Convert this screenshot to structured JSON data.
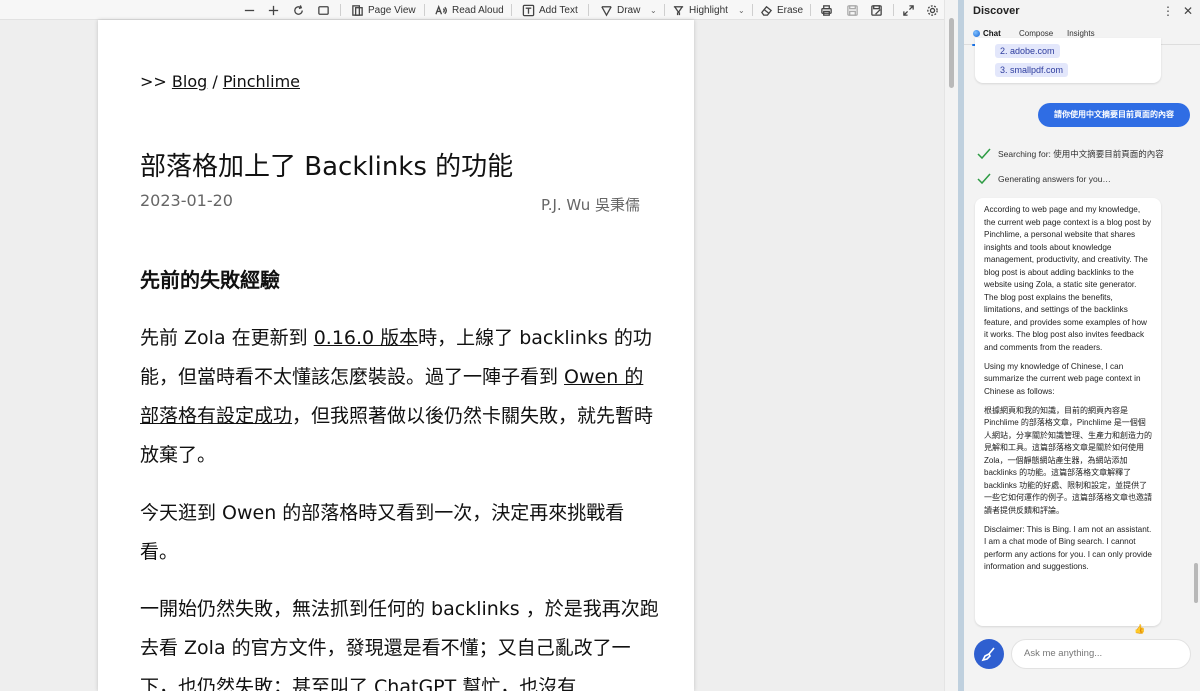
{
  "toolbar": {
    "page_view": "Page View",
    "read_aloud": "Read Aloud",
    "add_text": "Add Text",
    "draw": "Draw",
    "highlight": "Highlight",
    "erase": "Erase"
  },
  "document": {
    "crumb_prefix": ">>",
    "crumb_blog": "Blog",
    "crumb_sep": "/",
    "crumb_site": "Pinchlime",
    "title": "部落格加上了 Backlinks 的功能",
    "date": "2023-01-20",
    "author": "P.J. Wu 吳秉儒",
    "section_heading": "先前的失敗經驗",
    "p1_a": "先前 Zola 在更新到 ",
    "p1_link1": "0.16.0 版本",
    "p1_b": "時，上線了 backlinks 的功能，但當時看不太懂該怎麼裝設。過了一陣子看到 ",
    "p1_link2": "Owen 的部落格有設定成功",
    "p1_c": "，但我照著做以後仍然卡關失敗，就先暫時放棄了。",
    "p2": "今天逛到 Owen 的部落格時又看到一次，決定再來挑戰看看。",
    "p3": "一開始仍然失敗，無法抓到任何的 backlinks ，於是我再次跑去看 Zola 的官方文件，發現還是看不懂；又自己亂改了一下，也仍然失敗；甚至叫了 ChatGPT 幫忙，也沒有"
  },
  "sidebar": {
    "title": "Discover",
    "tabs": {
      "chat": "Chat",
      "compose": "Compose",
      "insights": "Insights"
    },
    "citations": [
      "2. adobe.com",
      "3. smallpdf.com"
    ],
    "user_message": "請你使用中文摘要目前頁面的內容",
    "status1": "Searching for: 使用中文摘要目前頁面的內容",
    "status2": "Generating answers for you…",
    "answer": {
      "p1": "According to web page and my knowledge, the current web page context is a blog post by Pinchlime, a personal website that shares insights and tools about knowledge management, productivity, and creativity. The blog post is about adding backlinks to the website using Zola, a static site generator. The blog post explains the benefits, limitations, and settings of the backlinks feature, and provides some examples of how it works. The blog post also invites feedback and comments from the readers.",
      "p2": "Using my knowledge of Chinese, I can summarize the current web page context in Chinese as follows:",
      "p3": "根據網頁和我的知識，目前的網頁內容是 Pinchlime 的部落格文章，Pinchlime 是一個個人網站，分享關於知識管理、生產力和創造力的見解和工具。這篇部落格文章是關於如何使用 Zola，一個靜態網站產生器，為網站添加 backlinks 的功能。這篇部落格文章解釋了 backlinks 功能的好處、限制和設定，並提供了一些它如何運作的例子。這篇部落格文章也邀請讀者提供反饋和評論。",
      "p4": "Disclaimer: This is Bing. I am not an assistant. I am a chat mode of Bing search. I cannot perform any actions for you. I can only provide information and suggestions."
    },
    "input_placeholder": "Ask me anything..."
  }
}
